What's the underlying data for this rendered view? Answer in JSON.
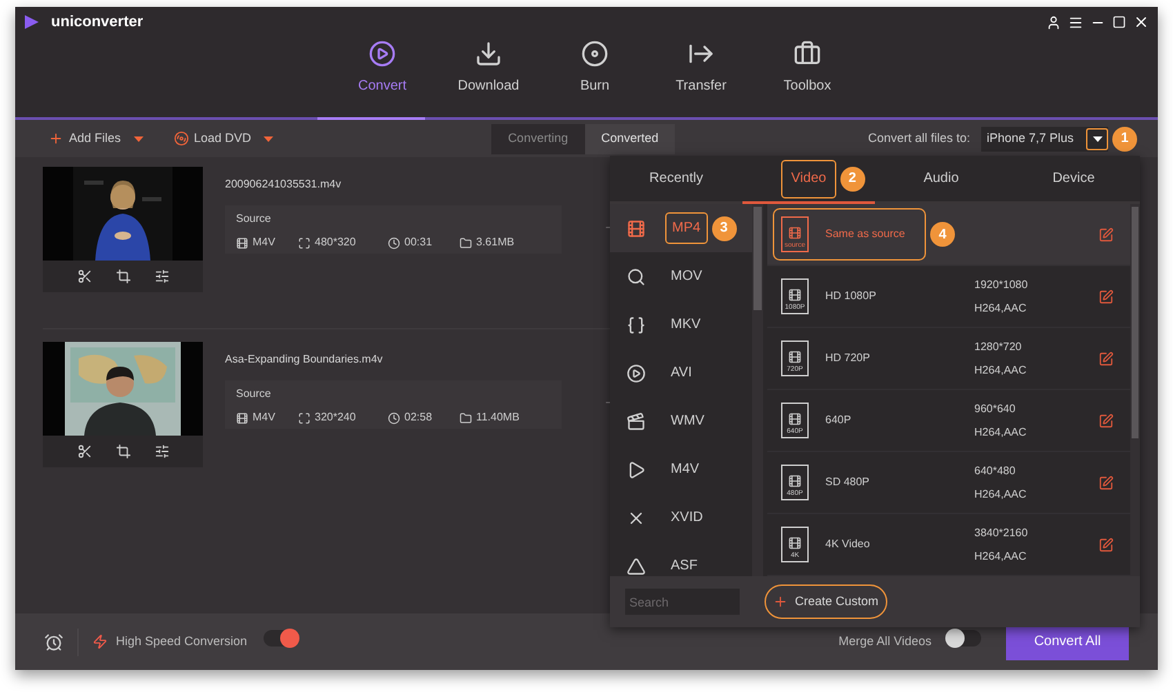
{
  "app": {
    "name": "uniconverter"
  },
  "nav": [
    {
      "label": "Convert",
      "selected": true
    },
    {
      "label": "Download",
      "selected": false
    },
    {
      "label": "Burn",
      "selected": false
    },
    {
      "label": "Transfer",
      "selected": false
    },
    {
      "label": "Toolbox",
      "selected": false
    }
  ],
  "toolbar": {
    "add_files": "Add Files",
    "load_dvd": "Load DVD",
    "tabs": [
      {
        "label": "Converting",
        "selected": true
      },
      {
        "label": "Converted",
        "selected": false
      }
    ],
    "convert_to_label": "Convert all files to:",
    "convert_to_value": "iPhone 7,7 Plus",
    "callout": "1"
  },
  "files": [
    {
      "name": "200906241035531.m4v",
      "source_label": "Source",
      "format": "M4V",
      "resolution": "480*320",
      "duration": "00:31",
      "size": "3.61MB"
    },
    {
      "name": "Asa-Expanding Boundaries.m4v",
      "source_label": "Source",
      "format": "M4V",
      "resolution": "320*240",
      "duration": "02:58",
      "size": "11.40MB"
    }
  ],
  "format_panel": {
    "tabs": [
      {
        "label": "Recently",
        "selected": false
      },
      {
        "label": "Video",
        "selected": true,
        "callout": "2"
      },
      {
        "label": "Audio",
        "selected": false
      },
      {
        "label": "Device",
        "selected": false
      }
    ],
    "formats": [
      {
        "label": "MP4",
        "selected": true,
        "callout": "3"
      },
      {
        "label": "MOV",
        "selected": false
      },
      {
        "label": "MKV",
        "selected": false
      },
      {
        "label": "AVI",
        "selected": false
      },
      {
        "label": "WMV",
        "selected": false
      },
      {
        "label": "M4V",
        "selected": false
      },
      {
        "label": "XVID",
        "selected": false
      },
      {
        "label": "ASF",
        "selected": false
      }
    ],
    "presets": [
      {
        "title": "Same as source",
        "badge": "source",
        "selected": true,
        "callout": "4"
      },
      {
        "title": "HD 1080P",
        "badge": "1080P",
        "resolution": "1920*1080",
        "codec": "H264,AAC",
        "selected": false
      },
      {
        "title": "HD 720P",
        "badge": "720P",
        "resolution": "1280*720",
        "codec": "H264,AAC",
        "selected": false
      },
      {
        "title": "640P",
        "badge": "640P",
        "resolution": "960*640",
        "codec": "H264,AAC",
        "selected": false
      },
      {
        "title": "SD 480P",
        "badge": "480P",
        "resolution": "640*480",
        "codec": "H264,AAC",
        "selected": false
      },
      {
        "title": "4K Video",
        "badge": "4K",
        "resolution": "3840*2160",
        "codec": "H264,AAC",
        "selected": false
      }
    ],
    "search": {
      "placeholder": "Search"
    },
    "create_custom": "Create Custom"
  },
  "bottom": {
    "high_speed": {
      "label": "High Speed Conversion",
      "on": true
    },
    "merge": {
      "label": "Merge All Videos",
      "on": false
    },
    "convert_all": "Convert All"
  }
}
